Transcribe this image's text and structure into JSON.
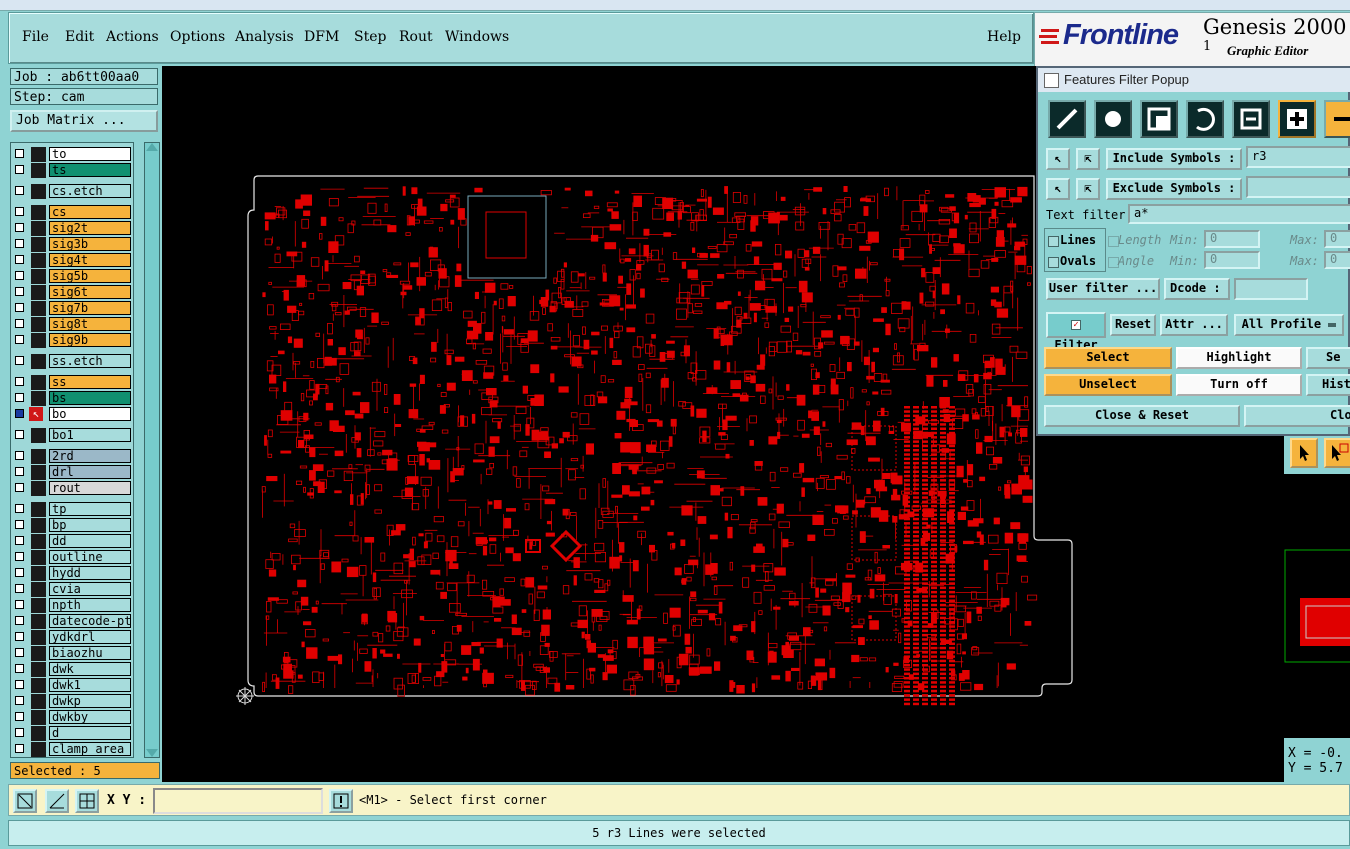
{
  "menu": {
    "items": [
      "File",
      "Edit",
      "Actions",
      "Options",
      "Analysis",
      "DFM",
      "Step",
      "Rout",
      "Windows"
    ],
    "help": "Help"
  },
  "brand": {
    "logo": "Frontline",
    "product": "Genesis 2000",
    "product_suffix": "1",
    "subtitle": "Graphic Editor"
  },
  "left": {
    "job": "Job : ab6tt00aa0",
    "step": "Step: cam",
    "job_matrix": "Job Matrix ...",
    "selected": "Selected : 5",
    "layers": [
      {
        "name": "to",
        "color": "#ffffff"
      },
      {
        "name": "ts",
        "color": "#109070"
      },
      {
        "name": "cs.etch",
        "color": "#a7dcdc"
      },
      {
        "name": "cs",
        "color": "#f5b33c"
      },
      {
        "name": "sig2t",
        "color": "#f5b33c"
      },
      {
        "name": "sig3b",
        "color": "#f5b33c"
      },
      {
        "name": "sig4t",
        "color": "#f5b33c"
      },
      {
        "name": "sig5b",
        "color": "#f5b33c"
      },
      {
        "name": "sig6t",
        "color": "#f5b33c"
      },
      {
        "name": "sig7b",
        "color": "#f5b33c"
      },
      {
        "name": "sig8t",
        "color": "#f5b33c"
      },
      {
        "name": "sig9b",
        "color": "#f5b33c"
      },
      {
        "name": "ss.etch",
        "color": "#a7dcdc"
      },
      {
        "name": "ss",
        "color": "#f5b33c"
      },
      {
        "name": "bs",
        "color": "#109070"
      },
      {
        "name": "bo",
        "color": "#ffffff"
      },
      {
        "name": "bo1",
        "color": "#a7dcdc"
      },
      {
        "name": "2rd",
        "color": "#9bb8c8"
      },
      {
        "name": "drl",
        "color": "#9bb8c8"
      },
      {
        "name": "rout",
        "color": "#d8d8d8"
      },
      {
        "name": "tp",
        "color": "#a7dcdc"
      },
      {
        "name": "bp",
        "color": "#a7dcdc"
      },
      {
        "name": "dd",
        "color": "#a7dcdc"
      },
      {
        "name": "outline",
        "color": "#a7dcdc"
      },
      {
        "name": "hydd",
        "color": "#a7dcdc"
      },
      {
        "name": "cvia",
        "color": "#a7dcdc"
      },
      {
        "name": "npth",
        "color": "#a7dcdc"
      },
      {
        "name": "datecode-pte",
        "color": "#a7dcdc"
      },
      {
        "name": "ydkdrl",
        "color": "#a7dcdc"
      },
      {
        "name": "biaozhu",
        "color": "#a7dcdc"
      },
      {
        "name": "dwk",
        "color": "#a7dcdc"
      },
      {
        "name": "dwk1",
        "color": "#a7dcdc"
      },
      {
        "name": "dwkp",
        "color": "#a7dcdc"
      },
      {
        "name": "dwkby",
        "color": "#a7dcdc"
      },
      {
        "name": "d",
        "color": "#a7dcdc"
      },
      {
        "name": "clamp_area",
        "color": "#a7dcdc"
      }
    ]
  },
  "popup": {
    "title": "Features Filter Popup",
    "include_label": "Include Symbols :",
    "include_value": "r3",
    "exclude_label": "Exclude Symbols :",
    "exclude_value": "",
    "text_filter_label": "Text filter",
    "text_filter_value": "a*",
    "lines_label": "Lines",
    "ovals_label": "Ovals",
    "length_label": "Length",
    "angle_label": "Angle",
    "min_label": "Min:",
    "max_label": "Max:",
    "min1": "0",
    "max1": "0",
    "min2": "0",
    "max2": "0",
    "user_filter": "User filter ...",
    "dcode": "Dcode :",
    "filter": "Filter",
    "reset": "Reset",
    "attr": "Attr ...",
    "profile": "All Profile",
    "select": "Select",
    "unselect": "Unselect",
    "highlight": "Highlight",
    "turn_off": "Turn off",
    "select_partial": "Se",
    "hist_partial": "Hist",
    "close_reset": "Close & Reset",
    "close_partial": "Clos"
  },
  "coords": {
    "x": "X = -0.",
    "y": "Y = 5.7"
  },
  "bottom": {
    "xy_label": "X Y :",
    "xy_value": "",
    "prompt": "<M1> - Select first corner"
  },
  "status": "5 r3 Lines were selected",
  "colors": {
    "trace": "#e00000",
    "panel": "#8fd3d3",
    "orange": "#f5b33c"
  }
}
